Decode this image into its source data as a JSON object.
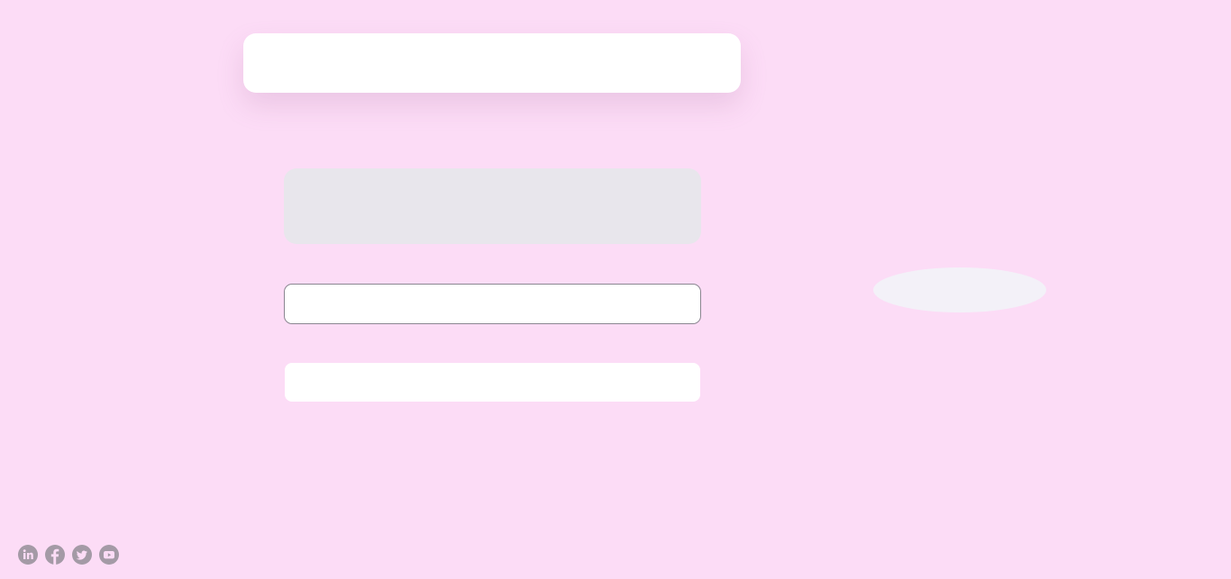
{
  "input": {
    "value": "",
    "placeholder": ""
  },
  "social": [
    {
      "icon": "linkedin-icon"
    },
    {
      "icon": "facebook-icon"
    },
    {
      "icon": "twitter-icon"
    },
    {
      "icon": "youtube-icon"
    }
  ],
  "colors": {
    "background": "#fcdcf6",
    "card": "#ffffff",
    "panel": "#e8e6ec",
    "input_border": "#8b8691",
    "icon": "#a49aa6"
  }
}
